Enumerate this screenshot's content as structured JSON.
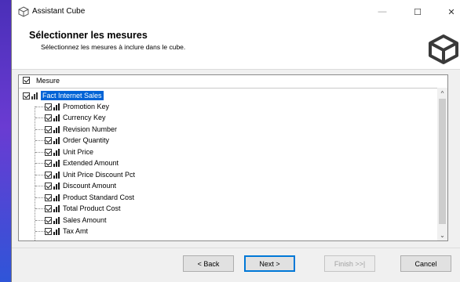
{
  "window": {
    "title": "Assistant Cube",
    "minimize": "—",
    "maximize": "☐",
    "close": "✕"
  },
  "header": {
    "title": "Sélectionner les mesures",
    "subtitle": "Sélectionnez les mesures à inclure dans le cube."
  },
  "tree": {
    "column_header": "Mesure",
    "root": "Fact Internet Sales",
    "items": [
      "Promotion Key",
      "Currency Key",
      "Revision Number",
      "Order Quantity",
      "Unit Price",
      "Extended Amount",
      "Unit Price Discount Pct",
      "Discount Amount",
      "Product Standard Cost",
      "Total Product Cost",
      "Sales Amount",
      "Tax Amt"
    ]
  },
  "buttons": {
    "back": "< Back",
    "next": "Next >",
    "finish": "Finish >>|",
    "cancel": "Cancel"
  },
  "colors": {
    "selection": "#0063d6",
    "primary_border": "#0078d7"
  }
}
